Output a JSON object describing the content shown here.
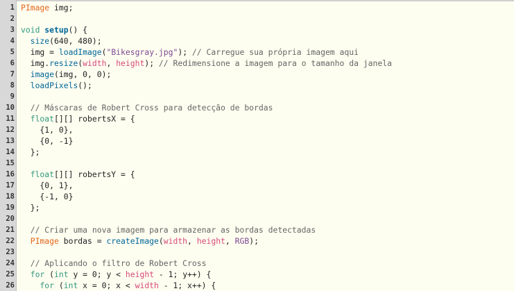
{
  "editor": {
    "lines": [
      {
        "n": "1",
        "tokens": [
          {
            "t": "PImage",
            "c": "ty"
          },
          {
            "t": " img;",
            "c": ""
          }
        ]
      },
      {
        "n": "2",
        "tokens": []
      },
      {
        "n": "3",
        "tokens": [
          {
            "t": "void",
            "c": "kw"
          },
          {
            "t": " ",
            "c": ""
          },
          {
            "t": "setup",
            "c": "fnb"
          },
          {
            "t": "() {",
            "c": ""
          }
        ]
      },
      {
        "n": "4",
        "tokens": [
          {
            "t": "  ",
            "c": ""
          },
          {
            "t": "size",
            "c": "fn"
          },
          {
            "t": "(640, 480);",
            "c": ""
          }
        ]
      },
      {
        "n": "5",
        "tokens": [
          {
            "t": "  img = ",
            "c": ""
          },
          {
            "t": "loadImage",
            "c": "fn"
          },
          {
            "t": "(",
            "c": ""
          },
          {
            "t": "\"Bikesgray.jpg\"",
            "c": "str"
          },
          {
            "t": "); ",
            "c": ""
          },
          {
            "t": "// Carregue sua própria imagem aqui",
            "c": "cm"
          }
        ]
      },
      {
        "n": "6",
        "tokens": [
          {
            "t": "  img.",
            "c": ""
          },
          {
            "t": "resize",
            "c": "fn"
          },
          {
            "t": "(",
            "c": ""
          },
          {
            "t": "width",
            "c": "var"
          },
          {
            "t": ", ",
            "c": ""
          },
          {
            "t": "height",
            "c": "var"
          },
          {
            "t": "); ",
            "c": ""
          },
          {
            "t": "// Redimensione a imagem para o tamanho da janela",
            "c": "cm"
          }
        ]
      },
      {
        "n": "7",
        "tokens": [
          {
            "t": "  ",
            "c": ""
          },
          {
            "t": "image",
            "c": "fn"
          },
          {
            "t": "(img, 0, 0);",
            "c": ""
          }
        ]
      },
      {
        "n": "8",
        "tokens": [
          {
            "t": "  ",
            "c": ""
          },
          {
            "t": "loadPixels",
            "c": "fn"
          },
          {
            "t": "();",
            "c": ""
          }
        ]
      },
      {
        "n": "9",
        "tokens": []
      },
      {
        "n": "10",
        "tokens": [
          {
            "t": "  ",
            "c": ""
          },
          {
            "t": "// Máscaras de Robert Cross para detecção de bordas",
            "c": "cm"
          }
        ]
      },
      {
        "n": "11",
        "tokens": [
          {
            "t": "  ",
            "c": ""
          },
          {
            "t": "float",
            "c": "kw"
          },
          {
            "t": "[][] robertsX = {",
            "c": ""
          }
        ]
      },
      {
        "n": "12",
        "tokens": [
          {
            "t": "    {1, 0},",
            "c": ""
          }
        ]
      },
      {
        "n": "13",
        "tokens": [
          {
            "t": "    {0, -1}",
            "c": ""
          }
        ]
      },
      {
        "n": "14",
        "tokens": [
          {
            "t": "  };",
            "c": ""
          }
        ]
      },
      {
        "n": "15",
        "tokens": []
      },
      {
        "n": "16",
        "tokens": [
          {
            "t": "  ",
            "c": ""
          },
          {
            "t": "float",
            "c": "kw"
          },
          {
            "t": "[][] robertsY = {",
            "c": ""
          }
        ]
      },
      {
        "n": "17",
        "tokens": [
          {
            "t": "    {0, 1},",
            "c": ""
          }
        ]
      },
      {
        "n": "18",
        "tokens": [
          {
            "t": "    {-1, 0}",
            "c": ""
          }
        ]
      },
      {
        "n": "19",
        "tokens": [
          {
            "t": "  };",
            "c": ""
          }
        ]
      },
      {
        "n": "20",
        "tokens": []
      },
      {
        "n": "21",
        "tokens": [
          {
            "t": "  ",
            "c": ""
          },
          {
            "t": "// Criar uma nova imagem para armazenar as bordas detectadas",
            "c": "cm"
          }
        ]
      },
      {
        "n": "22",
        "tokens": [
          {
            "t": "  ",
            "c": ""
          },
          {
            "t": "PImage",
            "c": "ty"
          },
          {
            "t": " bordas = ",
            "c": ""
          },
          {
            "t": "createImage",
            "c": "fn"
          },
          {
            "t": "(",
            "c": ""
          },
          {
            "t": "width",
            "c": "var"
          },
          {
            "t": ", ",
            "c": ""
          },
          {
            "t": "height",
            "c": "var"
          },
          {
            "t": ", ",
            "c": ""
          },
          {
            "t": "RGB",
            "c": "str"
          },
          {
            "t": ");",
            "c": ""
          }
        ]
      },
      {
        "n": "23",
        "tokens": []
      },
      {
        "n": "24",
        "tokens": [
          {
            "t": "  ",
            "c": ""
          },
          {
            "t": "// Aplicando o filtro de Robert Cross",
            "c": "cm"
          }
        ]
      },
      {
        "n": "25",
        "tokens": [
          {
            "t": "  ",
            "c": ""
          },
          {
            "t": "for",
            "c": "kw"
          },
          {
            "t": " (",
            "c": ""
          },
          {
            "t": "int",
            "c": "kw"
          },
          {
            "t": " y = 0; y < ",
            "c": ""
          },
          {
            "t": "height",
            "c": "var"
          },
          {
            "t": " - 1; y++) {",
            "c": ""
          }
        ]
      },
      {
        "n": "26",
        "tokens": [
          {
            "t": "    ",
            "c": ""
          },
          {
            "t": "for",
            "c": "kw"
          },
          {
            "t": " (",
            "c": ""
          },
          {
            "t": "int",
            "c": "kw"
          },
          {
            "t": " x = 0; x < ",
            "c": ""
          },
          {
            "t": "width",
            "c": "var"
          },
          {
            "t": " - 1; x++) {",
            "c": ""
          }
        ]
      }
    ]
  }
}
